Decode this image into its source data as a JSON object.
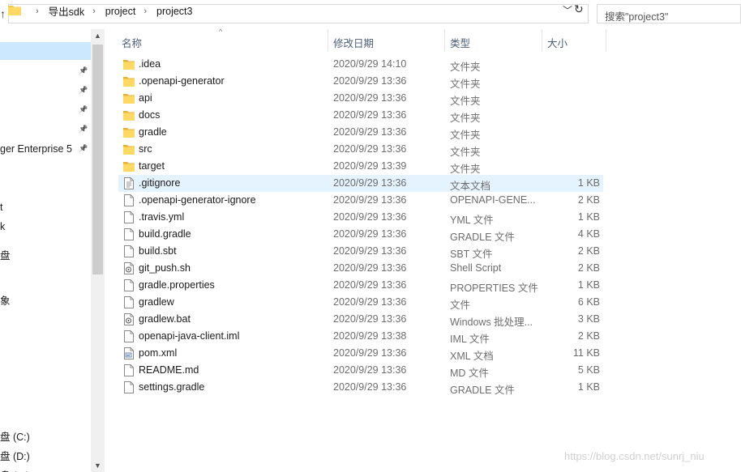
{
  "address": {
    "crumbs": [
      "导出sdk",
      "project",
      "project3"
    ],
    "search_placeholder": "搜索\"project3\""
  },
  "nav": {
    "items": [
      {
        "label": "",
        "pinned": false
      },
      {
        "label": "",
        "pinned": true
      },
      {
        "label": "",
        "pinned": true
      },
      {
        "label": "",
        "pinned": true
      },
      {
        "label": "",
        "pinned": true
      },
      {
        "label": "ger Enterprise 5",
        "pinned": true
      },
      {
        "label": "t",
        "pinned": false
      },
      {
        "label": "k",
        "pinned": false
      },
      {
        "label": "盘",
        "pinned": false
      },
      {
        "label": "象",
        "pinned": false
      },
      {
        "label": "盘 (C:)",
        "pinned": false
      },
      {
        "label": "盘 (D:)",
        "pinned": false
      },
      {
        "label": "盘 (E:)",
        "pinned": false
      }
    ]
  },
  "columns": {
    "name": "名称",
    "date": "修改日期",
    "type": "类型",
    "size": "大小"
  },
  "files": [
    {
      "name": ".idea",
      "date": "2020/9/29 14:10",
      "type": "文件夹",
      "size": "",
      "icon": "folder-icon"
    },
    {
      "name": ".openapi-generator",
      "date": "2020/9/29 13:36",
      "type": "文件夹",
      "size": "",
      "icon": "folder-icon"
    },
    {
      "name": "api",
      "date": "2020/9/29 13:36",
      "type": "文件夹",
      "size": "",
      "icon": "folder-icon"
    },
    {
      "name": "docs",
      "date": "2020/9/29 13:36",
      "type": "文件夹",
      "size": "",
      "icon": "folder-icon"
    },
    {
      "name": "gradle",
      "date": "2020/9/29 13:36",
      "type": "文件夹",
      "size": "",
      "icon": "folder-icon"
    },
    {
      "name": "src",
      "date": "2020/9/29 13:36",
      "type": "文件夹",
      "size": "",
      "icon": "folder-icon"
    },
    {
      "name": "target",
      "date": "2020/9/29 13:39",
      "type": "文件夹",
      "size": "",
      "icon": "folder-icon"
    },
    {
      "name": ".gitignore",
      "date": "2020/9/29 13:36",
      "type": "文本文档",
      "size": "1 KB",
      "icon": "text-file-icon"
    },
    {
      "name": ".openapi-generator-ignore",
      "date": "2020/9/29 13:36",
      "type": "OPENAPI-GENE...",
      "size": "2 KB",
      "icon": "file-icon"
    },
    {
      "name": ".travis.yml",
      "date": "2020/9/29 13:36",
      "type": "YML 文件",
      "size": "1 KB",
      "icon": "file-icon"
    },
    {
      "name": "build.gradle",
      "date": "2020/9/29 13:36",
      "type": "GRADLE 文件",
      "size": "4 KB",
      "icon": "file-icon"
    },
    {
      "name": "build.sbt",
      "date": "2020/9/29 13:36",
      "type": "SBT 文件",
      "size": "2 KB",
      "icon": "file-icon"
    },
    {
      "name": "git_push.sh",
      "date": "2020/9/29 13:36",
      "type": "Shell Script",
      "size": "2 KB",
      "icon": "script-file-icon"
    },
    {
      "name": "gradle.properties",
      "date": "2020/9/29 13:36",
      "type": "PROPERTIES 文件",
      "size": "1 KB",
      "icon": "file-icon"
    },
    {
      "name": "gradlew",
      "date": "2020/9/29 13:36",
      "type": "文件",
      "size": "6 KB",
      "icon": "file-icon"
    },
    {
      "name": "gradlew.bat",
      "date": "2020/9/29 13:36",
      "type": "Windows 批处理...",
      "size": "3 KB",
      "icon": "script-file-icon"
    },
    {
      "name": "openapi-java-client.iml",
      "date": "2020/9/29 13:38",
      "type": "IML 文件",
      "size": "2 KB",
      "icon": "file-icon"
    },
    {
      "name": "pom.xml",
      "date": "2020/9/29 13:36",
      "type": "XML 文档",
      "size": "11 KB",
      "icon": "xml-file-icon"
    },
    {
      "name": "README.md",
      "date": "2020/9/29 13:36",
      "type": "MD 文件",
      "size": "5 KB",
      "icon": "file-icon"
    },
    {
      "name": "settings.gradle",
      "date": "2020/9/29 13:36",
      "type": "GRADLE 文件",
      "size": "1 KB",
      "icon": "file-icon"
    }
  ],
  "hover_row": ".gitignore",
  "watermark": "https://blog.csdn.net/sunrj_niu",
  "colors": {
    "selection": "#cce8ff",
    "hover": "#e5f3ff",
    "folder": "#f2c94c",
    "header_text": "#4c607a"
  }
}
